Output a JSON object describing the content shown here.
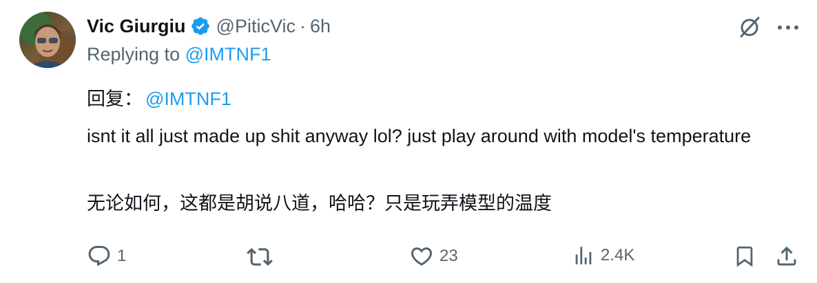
{
  "author": {
    "name": "Vic Giurgiu",
    "handle": "@PiticVic",
    "separator": "·",
    "time": "6h",
    "verified_icon": "verified-badge-icon"
  },
  "reply": {
    "prefix": "Replying to",
    "to": "@IMTNF1"
  },
  "translated_reply": {
    "prefix": "回复：",
    "to": "@IMTNF1"
  },
  "tweet": {
    "text": "isnt it all just made up shit anyway lol? just play around with model's temperature",
    "translation": "无论如何，这都是胡说八道，哈哈？只是玩弄模型的温度"
  },
  "top_icons": [
    "grok-icon",
    "more-icon"
  ],
  "actions": {
    "reply_count": "1",
    "retweet_count": "",
    "like_count": "23",
    "views_count": "2.4K"
  },
  "colors": {
    "accent": "#1d9bf0",
    "text": "#0f1419",
    "muted": "#536471"
  }
}
